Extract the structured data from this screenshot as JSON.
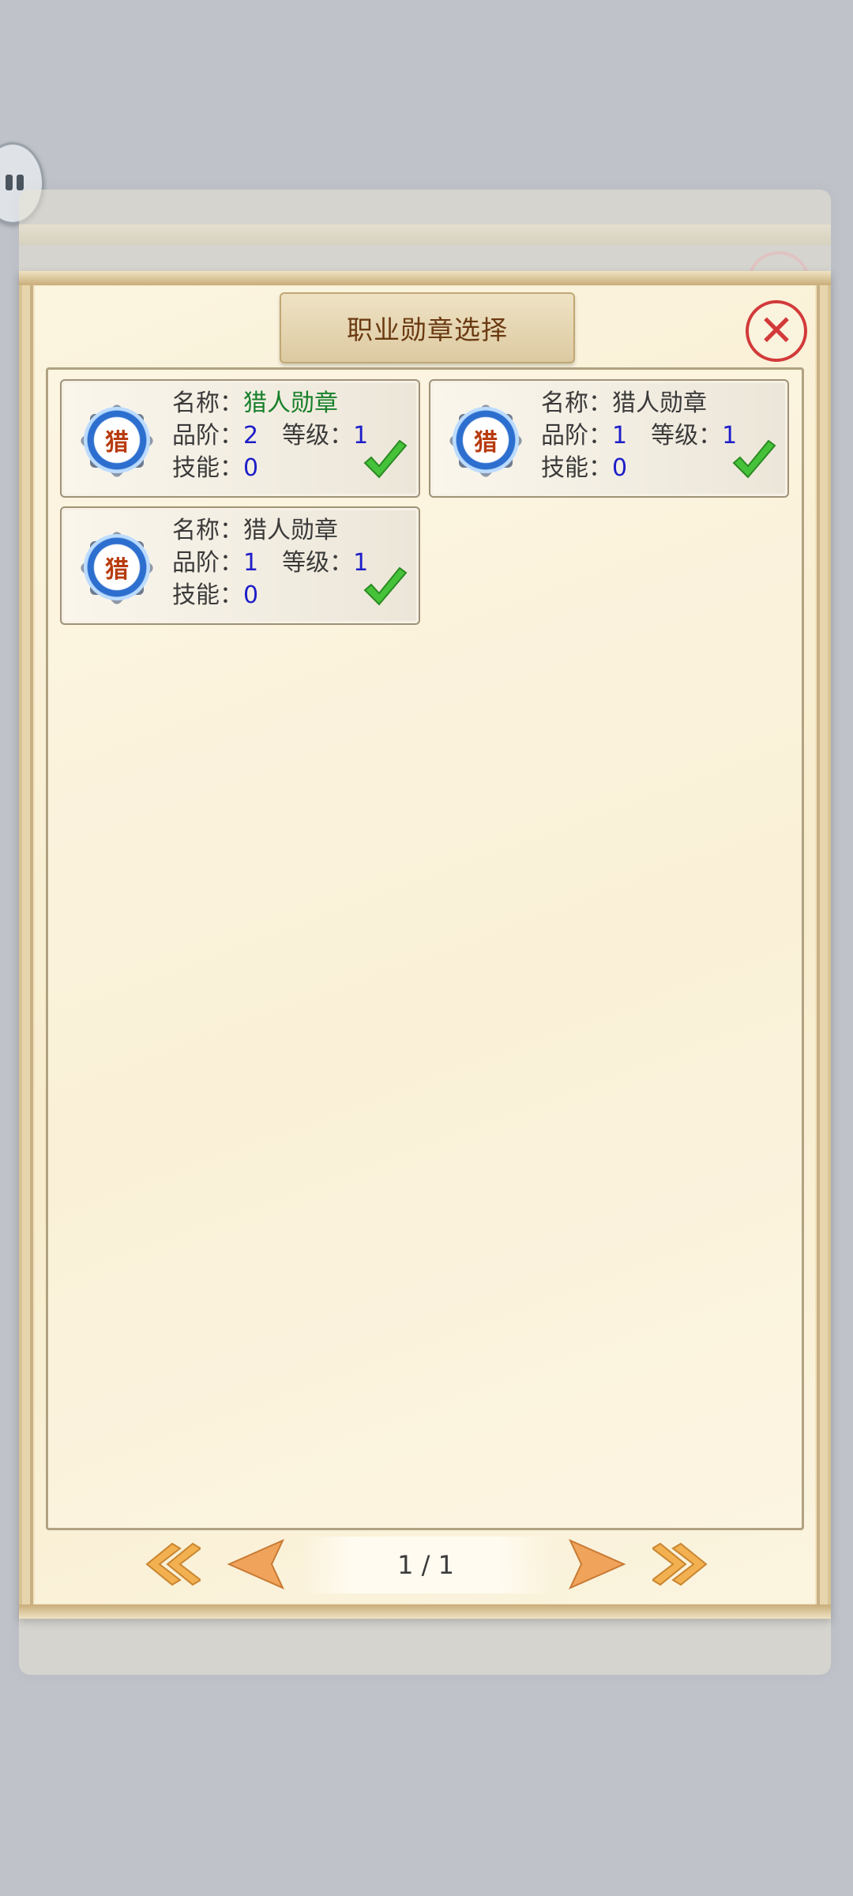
{
  "dialog": {
    "title": "职业勋章选择"
  },
  "labels": {
    "name": "名称：",
    "grade": "品阶：",
    "level": "等级：",
    "skill": "技能："
  },
  "medals": [
    {
      "icon_char": "猎",
      "name": "猎人勋章",
      "grade": "2",
      "level": "1",
      "skill": "0",
      "name_color": "#17802a",
      "checked": true
    },
    {
      "icon_char": "猎",
      "name": "猎人勋章",
      "grade": "1",
      "level": "1",
      "skill": "0",
      "name_color": "#3a3a3a",
      "checked": true
    },
    {
      "icon_char": "猎",
      "name": "猎人勋章",
      "grade": "1",
      "level": "1",
      "skill": "0",
      "name_color": "#3a3a3a",
      "checked": true
    }
  ],
  "pagination": {
    "page_text": "1 / 1"
  },
  "colors": {
    "value_blue": "#1e1ec9",
    "close_red": "#d23a3a",
    "check_green": "#46c23a"
  }
}
